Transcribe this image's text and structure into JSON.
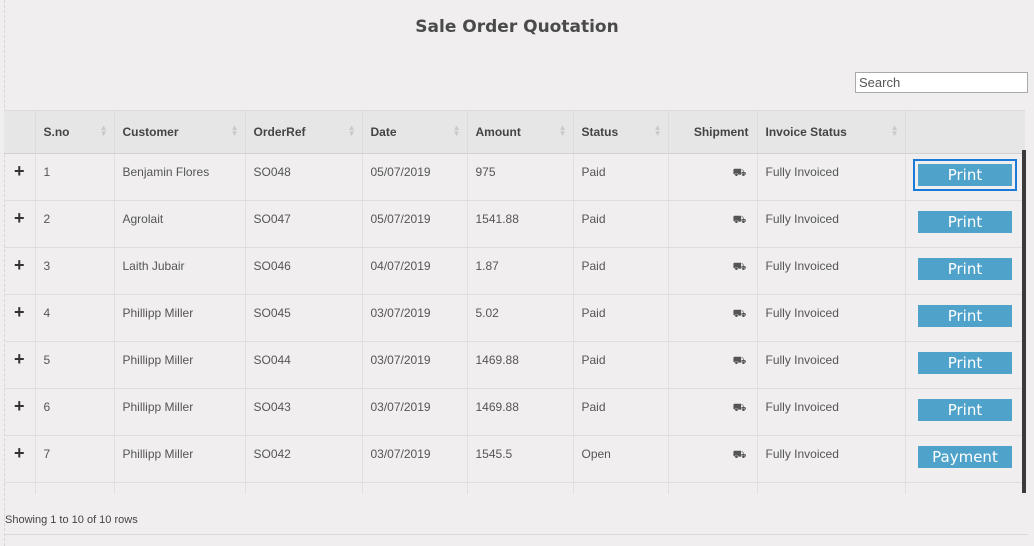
{
  "page": {
    "title": "Sale Order Quotation"
  },
  "search": {
    "placeholder": "Search"
  },
  "table": {
    "headers": [
      "",
      "S.no",
      "Customer",
      "OrderRef",
      "Date",
      "Amount",
      "Status",
      "Shipment",
      "Invoice Status",
      ""
    ],
    "rows": [
      {
        "sno": "1",
        "customer": "Benjamin Flores",
        "ref": "SO048",
        "date": "05/07/2019",
        "amount": "975",
        "status": "Paid",
        "invoice": "Fully Invoiced",
        "action": "Print"
      },
      {
        "sno": "2",
        "customer": "Agrolait",
        "ref": "SO047",
        "date": "05/07/2019",
        "amount": "1541.88",
        "status": "Paid",
        "invoice": "Fully Invoiced",
        "action": "Print"
      },
      {
        "sno": "3",
        "customer": "Laith Jubair",
        "ref": "SO046",
        "date": "04/07/2019",
        "amount": "1.87",
        "status": "Paid",
        "invoice": "Fully Invoiced",
        "action": "Print"
      },
      {
        "sno": "4",
        "customer": "Phillipp Miller",
        "ref": "SO045",
        "date": "03/07/2019",
        "amount": "5.02",
        "status": "Paid",
        "invoice": "Fully Invoiced",
        "action": "Print"
      },
      {
        "sno": "5",
        "customer": "Phillipp Miller",
        "ref": "SO044",
        "date": "03/07/2019",
        "amount": "1469.88",
        "status": "Paid",
        "invoice": "Fully Invoiced",
        "action": "Print"
      },
      {
        "sno": "6",
        "customer": "Phillipp Miller",
        "ref": "SO043",
        "date": "03/07/2019",
        "amount": "1469.88",
        "status": "Paid",
        "invoice": "Fully Invoiced",
        "action": "Print"
      },
      {
        "sno": "7",
        "customer": "Phillipp Miller",
        "ref": "SO042",
        "date": "03/07/2019",
        "amount": "1545.5",
        "status": "Open",
        "invoice": "Fully Invoiced",
        "action": "Payment"
      }
    ],
    "expand_symbol": "+",
    "shipment_icon": "truck-icon"
  },
  "footer": {
    "pagination_text": "Showing 1 to 10 of 10 rows"
  },
  "colors": {
    "button": "#4fa2c9",
    "focus_ring": "#1a7ad9",
    "header_bg": "#e6e6e6",
    "page_bg": "#f0eeee"
  }
}
